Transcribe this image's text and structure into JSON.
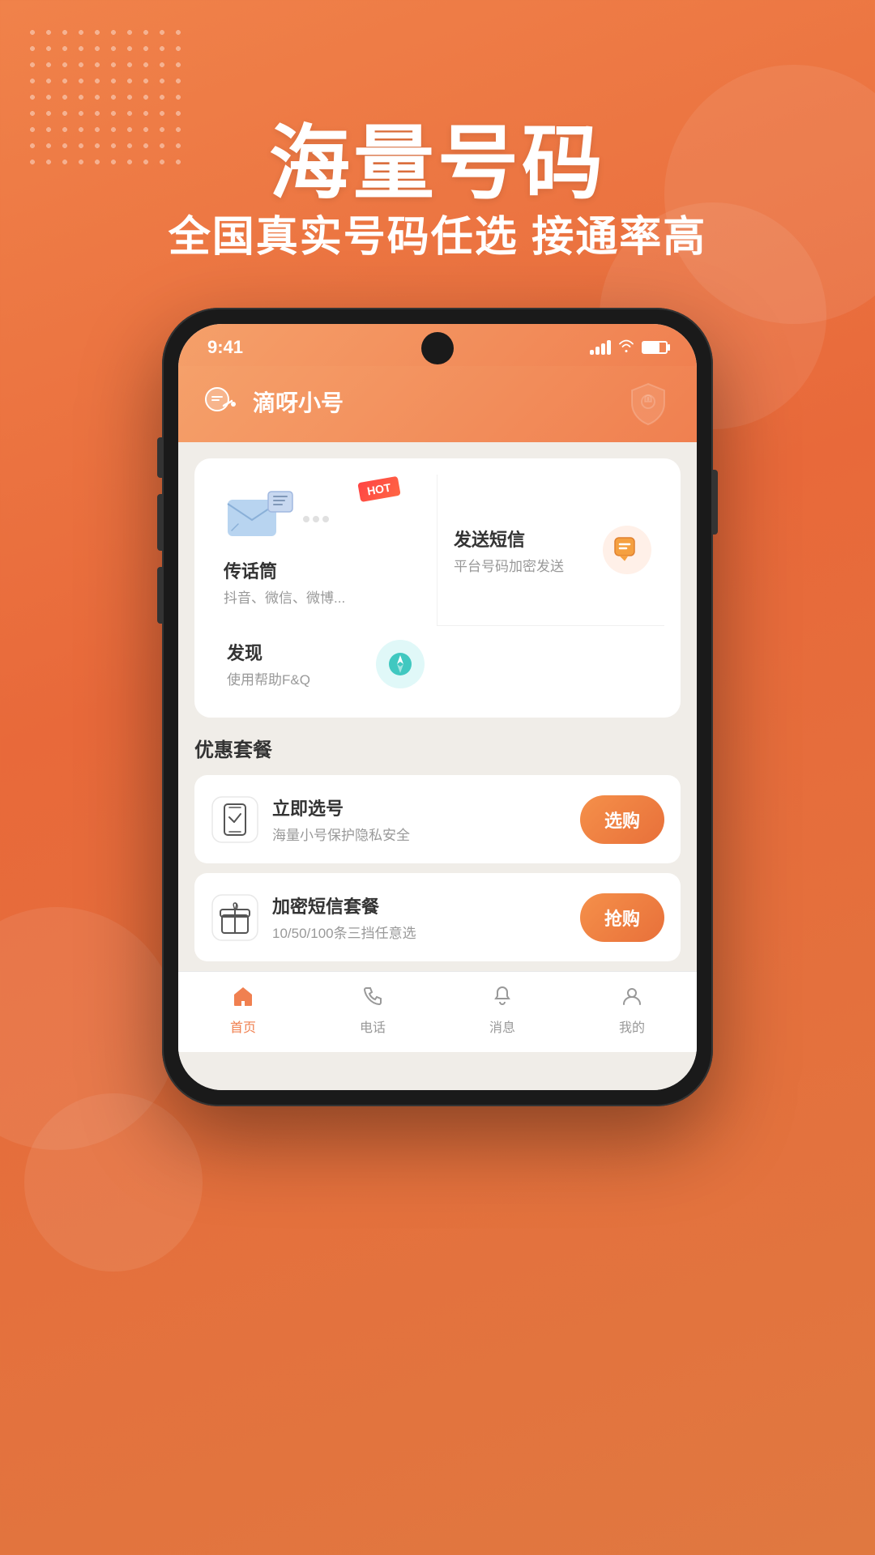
{
  "background": {
    "gradient_start": "#f0824a",
    "gradient_end": "#e07840"
  },
  "hero": {
    "title": "海量号码",
    "subtitle": "全国真实号码任选 接通率高"
  },
  "phone": {
    "status_bar": {
      "time": "9:41",
      "signal": "signal",
      "wifi": "wifi",
      "battery": "battery"
    },
    "app_header": {
      "title": "滴呀小号"
    },
    "features": {
      "item1": {
        "title": "传话筒",
        "desc": "抖音、微信、微博..."
      },
      "item2": {
        "title": "发送短信",
        "desc": "平台号码加密发送"
      },
      "item3": {
        "title": "发现",
        "desc": "使用帮助F&Q"
      },
      "hot_badge": "HOT"
    },
    "packages": {
      "section_title": "优惠套餐",
      "item1": {
        "name": "立即选号",
        "desc": "海量小号保护隐私安全",
        "btn": "选购"
      },
      "item2": {
        "name": "加密短信套餐",
        "desc": "10/50/100条三挡任意选",
        "btn": "抢购"
      }
    },
    "bottom_nav": {
      "items": [
        {
          "label": "首页",
          "active": true
        },
        {
          "label": "电话",
          "active": false
        },
        {
          "label": "消息",
          "active": false
        },
        {
          "label": "我的",
          "active": false
        }
      ]
    }
  }
}
